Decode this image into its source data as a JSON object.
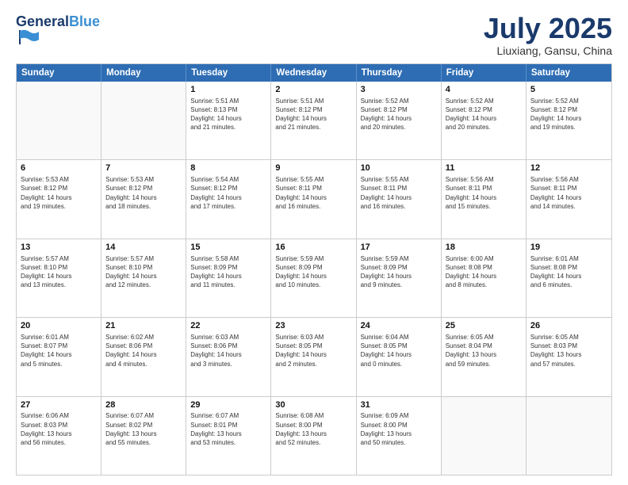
{
  "header": {
    "logo_line1": "General",
    "logo_line2": "Blue",
    "month": "July 2025",
    "location": "Liuxiang, Gansu, China"
  },
  "weekdays": [
    "Sunday",
    "Monday",
    "Tuesday",
    "Wednesday",
    "Thursday",
    "Friday",
    "Saturday"
  ],
  "rows": [
    [
      {
        "day": "",
        "info": ""
      },
      {
        "day": "",
        "info": ""
      },
      {
        "day": "1",
        "info": "Sunrise: 5:51 AM\nSunset: 8:13 PM\nDaylight: 14 hours\nand 21 minutes."
      },
      {
        "day": "2",
        "info": "Sunrise: 5:51 AM\nSunset: 8:12 PM\nDaylight: 14 hours\nand 21 minutes."
      },
      {
        "day": "3",
        "info": "Sunrise: 5:52 AM\nSunset: 8:12 PM\nDaylight: 14 hours\nand 20 minutes."
      },
      {
        "day": "4",
        "info": "Sunrise: 5:52 AM\nSunset: 8:12 PM\nDaylight: 14 hours\nand 20 minutes."
      },
      {
        "day": "5",
        "info": "Sunrise: 5:52 AM\nSunset: 8:12 PM\nDaylight: 14 hours\nand 19 minutes."
      }
    ],
    [
      {
        "day": "6",
        "info": "Sunrise: 5:53 AM\nSunset: 8:12 PM\nDaylight: 14 hours\nand 19 minutes."
      },
      {
        "day": "7",
        "info": "Sunrise: 5:53 AM\nSunset: 8:12 PM\nDaylight: 14 hours\nand 18 minutes."
      },
      {
        "day": "8",
        "info": "Sunrise: 5:54 AM\nSunset: 8:12 PM\nDaylight: 14 hours\nand 17 minutes."
      },
      {
        "day": "9",
        "info": "Sunrise: 5:55 AM\nSunset: 8:11 PM\nDaylight: 14 hours\nand 16 minutes."
      },
      {
        "day": "10",
        "info": "Sunrise: 5:55 AM\nSunset: 8:11 PM\nDaylight: 14 hours\nand 16 minutes."
      },
      {
        "day": "11",
        "info": "Sunrise: 5:56 AM\nSunset: 8:11 PM\nDaylight: 14 hours\nand 15 minutes."
      },
      {
        "day": "12",
        "info": "Sunrise: 5:56 AM\nSunset: 8:11 PM\nDaylight: 14 hours\nand 14 minutes."
      }
    ],
    [
      {
        "day": "13",
        "info": "Sunrise: 5:57 AM\nSunset: 8:10 PM\nDaylight: 14 hours\nand 13 minutes."
      },
      {
        "day": "14",
        "info": "Sunrise: 5:57 AM\nSunset: 8:10 PM\nDaylight: 14 hours\nand 12 minutes."
      },
      {
        "day": "15",
        "info": "Sunrise: 5:58 AM\nSunset: 8:09 PM\nDaylight: 14 hours\nand 11 minutes."
      },
      {
        "day": "16",
        "info": "Sunrise: 5:59 AM\nSunset: 8:09 PM\nDaylight: 14 hours\nand 10 minutes."
      },
      {
        "day": "17",
        "info": "Sunrise: 5:59 AM\nSunset: 8:09 PM\nDaylight: 14 hours\nand 9 minutes."
      },
      {
        "day": "18",
        "info": "Sunrise: 6:00 AM\nSunset: 8:08 PM\nDaylight: 14 hours\nand 8 minutes."
      },
      {
        "day": "19",
        "info": "Sunrise: 6:01 AM\nSunset: 8:08 PM\nDaylight: 14 hours\nand 6 minutes."
      }
    ],
    [
      {
        "day": "20",
        "info": "Sunrise: 6:01 AM\nSunset: 8:07 PM\nDaylight: 14 hours\nand 5 minutes."
      },
      {
        "day": "21",
        "info": "Sunrise: 6:02 AM\nSunset: 8:06 PM\nDaylight: 14 hours\nand 4 minutes."
      },
      {
        "day": "22",
        "info": "Sunrise: 6:03 AM\nSunset: 8:06 PM\nDaylight: 14 hours\nand 3 minutes."
      },
      {
        "day": "23",
        "info": "Sunrise: 6:03 AM\nSunset: 8:05 PM\nDaylight: 14 hours\nand 2 minutes."
      },
      {
        "day": "24",
        "info": "Sunrise: 6:04 AM\nSunset: 8:05 PM\nDaylight: 14 hours\nand 0 minutes."
      },
      {
        "day": "25",
        "info": "Sunrise: 6:05 AM\nSunset: 8:04 PM\nDaylight: 13 hours\nand 59 minutes."
      },
      {
        "day": "26",
        "info": "Sunrise: 6:05 AM\nSunset: 8:03 PM\nDaylight: 13 hours\nand 57 minutes."
      }
    ],
    [
      {
        "day": "27",
        "info": "Sunrise: 6:06 AM\nSunset: 8:03 PM\nDaylight: 13 hours\nand 56 minutes."
      },
      {
        "day": "28",
        "info": "Sunrise: 6:07 AM\nSunset: 8:02 PM\nDaylight: 13 hours\nand 55 minutes."
      },
      {
        "day": "29",
        "info": "Sunrise: 6:07 AM\nSunset: 8:01 PM\nDaylight: 13 hours\nand 53 minutes."
      },
      {
        "day": "30",
        "info": "Sunrise: 6:08 AM\nSunset: 8:00 PM\nDaylight: 13 hours\nand 52 minutes."
      },
      {
        "day": "31",
        "info": "Sunrise: 6:09 AM\nSunset: 8:00 PM\nDaylight: 13 hours\nand 50 minutes."
      },
      {
        "day": "",
        "info": ""
      },
      {
        "day": "",
        "info": ""
      }
    ]
  ]
}
